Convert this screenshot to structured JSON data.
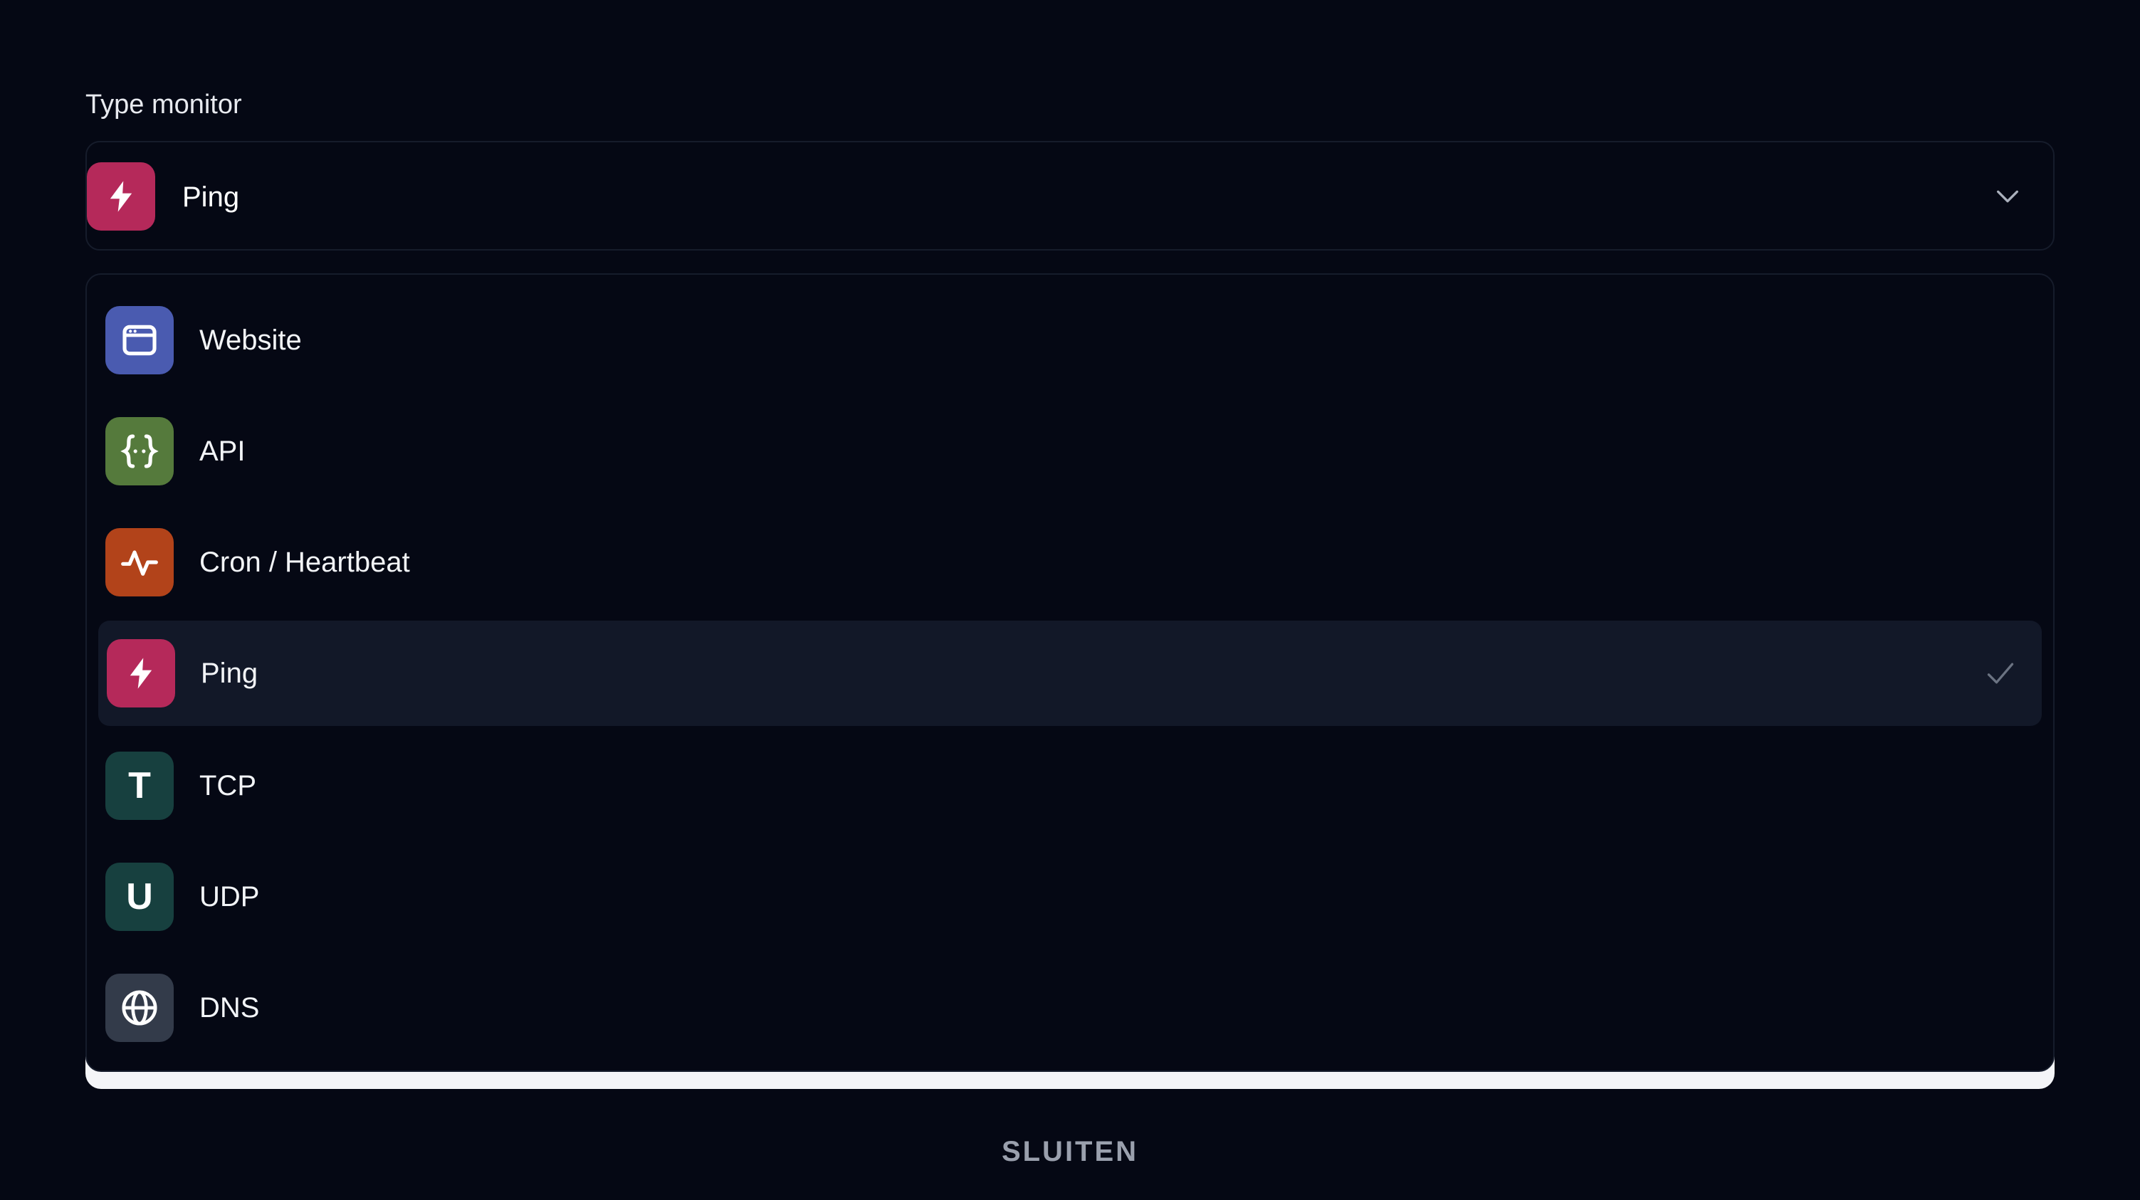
{
  "field": {
    "label": "Type monitor",
    "selected_value": "Ping",
    "selected_icon": "bolt-icon",
    "selected_color": "#b5295a"
  },
  "options": [
    {
      "label": "Website",
      "icon": "browser-window-icon",
      "color": "#4a5bb0"
    },
    {
      "label": "API",
      "icon": "curly-braces-icon",
      "color": "#557a3c"
    },
    {
      "label": "Cron / Heartbeat",
      "icon": "pulse-icon",
      "color": "#b2431a"
    },
    {
      "label": "Ping",
      "icon": "bolt-icon",
      "color": "#b5295a",
      "selected": true
    },
    {
      "label": "TCP",
      "icon": "letter-t-icon",
      "color": "#17403f",
      "glyph": "T"
    },
    {
      "label": "UDP",
      "icon": "letter-u-icon",
      "color": "#17403f",
      "glyph": "U"
    },
    {
      "label": "DNS",
      "icon": "globe-icon",
      "color": "#333b4a"
    }
  ],
  "footer": {
    "close_label": "SLUITEN"
  }
}
